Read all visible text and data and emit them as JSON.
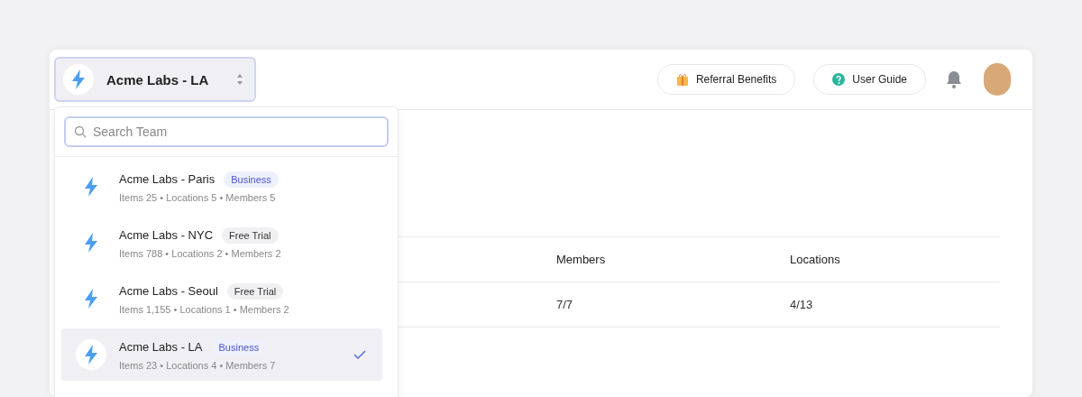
{
  "team_switcher": {
    "name": "Acme Labs - LA",
    "expanded": true
  },
  "header_buttons": [
    {
      "kind": "gift",
      "label": "Referral Benefits"
    },
    {
      "kind": "help",
      "label": "User Guide"
    }
  ],
  "dropdown": {
    "search": {
      "placeholder": "Search Team"
    },
    "teams": [
      {
        "name": "Acme Labs - Paris",
        "plan": {
          "label": "Business",
          "kind": "paid"
        },
        "stats": "Items 25 • Locations 5 • Members 5",
        "selected": false
      },
      {
        "name": "Acme Labs - NYC",
        "plan": {
          "label": "Free Trial",
          "kind": "trial"
        },
        "stats": "Items 788 • Locations 2 • Members 2",
        "selected": false
      },
      {
        "name": "Acme Labs - Seoul",
        "plan": {
          "label": "Free Trial",
          "kind": "trial"
        },
        "stats": "Items 1,155 • Locations 1 • Members 2",
        "selected": false
      },
      {
        "name": "Acme Labs - LA",
        "plan": {
          "label": "Business",
          "kind": "paid"
        },
        "stats": "Items 23 • Locations 4 • Members 7",
        "selected": true
      }
    ]
  },
  "table": {
    "columns": [
      "Members",
      "Locations"
    ],
    "rows": [
      [
        "7/7",
        "4/13"
      ]
    ]
  }
}
